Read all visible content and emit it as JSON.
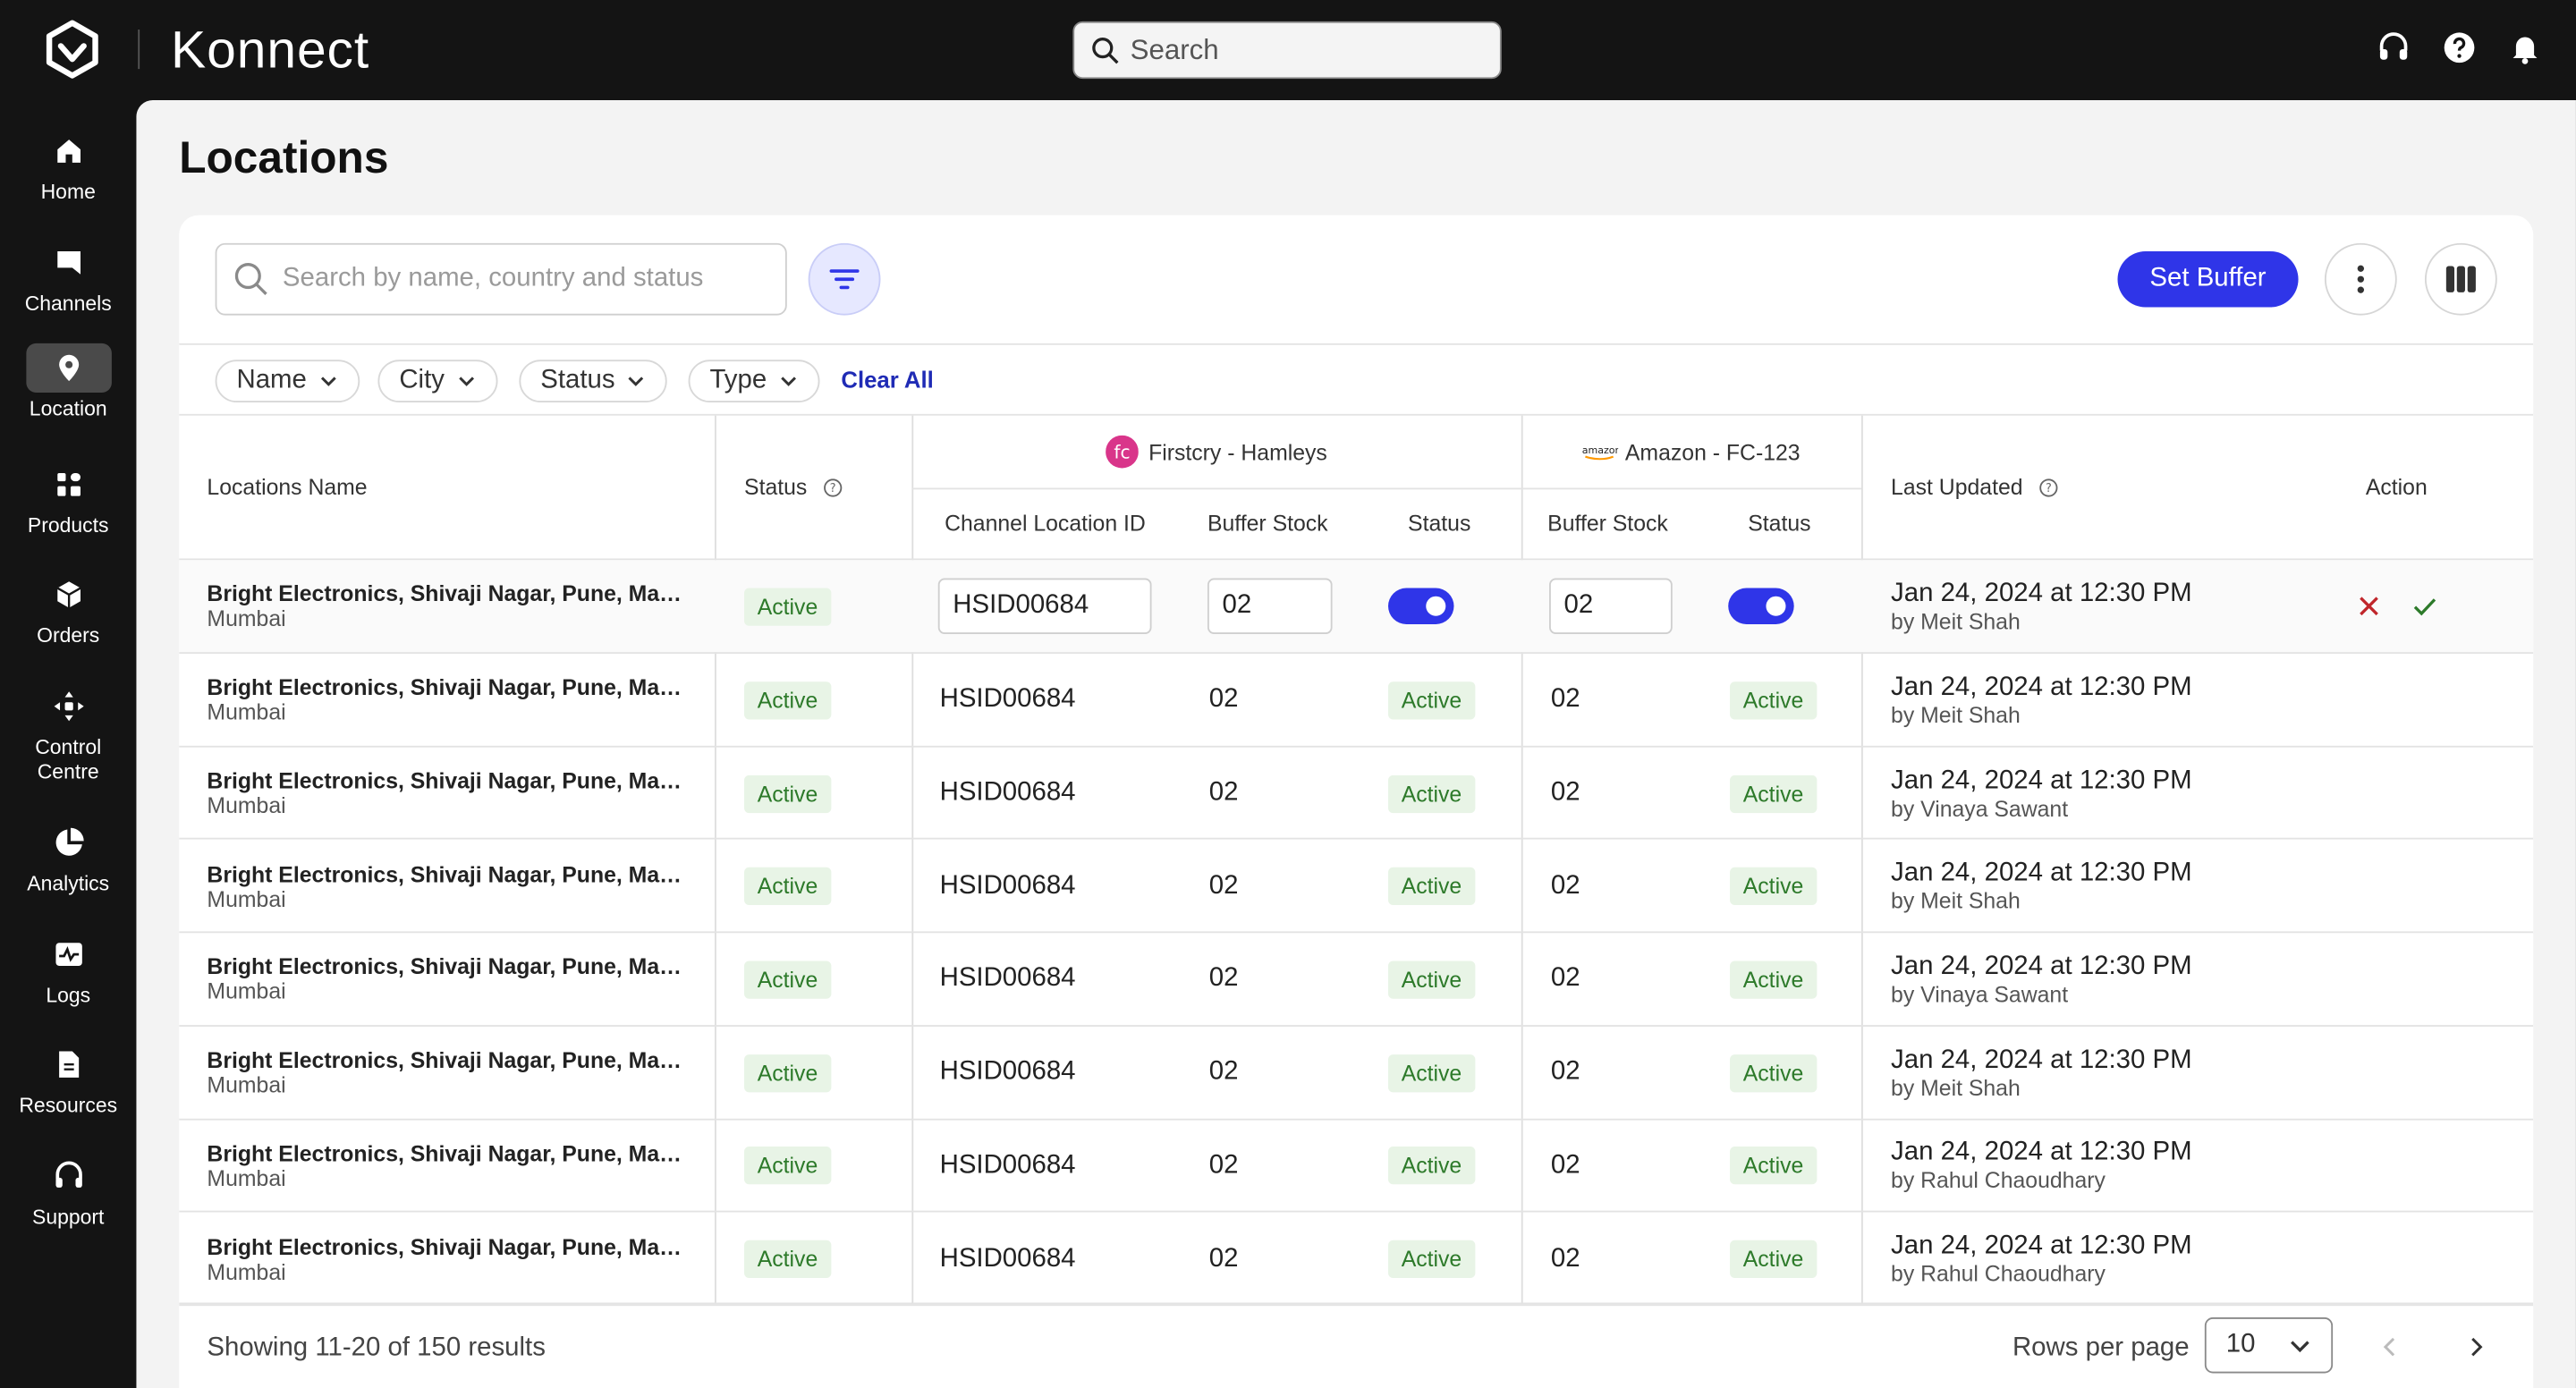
{
  "app": {
    "brand": "Konnect"
  },
  "header": {
    "search_placeholder": "Search"
  },
  "colors": {
    "accent": "#2f35e8",
    "active_badge_bg": "#e8f4e6",
    "active_badge_text": "#2d7a2a",
    "topbar": "#141414"
  },
  "sidebar": {
    "items": [
      {
        "label": "Home",
        "icon": "home-icon"
      },
      {
        "label": "Channels",
        "icon": "channels-icon"
      },
      {
        "label": "Location",
        "icon": "location-pin-icon",
        "active": true
      },
      {
        "label": "Products",
        "icon": "products-icon"
      },
      {
        "label": "Orders",
        "icon": "orders-box-icon"
      },
      {
        "label": "Control",
        "label2": "Centre",
        "icon": "control-centre-icon"
      },
      {
        "label": "Analytics",
        "icon": "analytics-pie-icon"
      },
      {
        "label": "Logs",
        "icon": "logs-icon"
      },
      {
        "label": "Resources",
        "icon": "resources-doc-icon"
      },
      {
        "label": "Support",
        "icon": "support-headset-icon"
      }
    ]
  },
  "page": {
    "title": "Locations",
    "search_placeholder": "Search by name, country and status",
    "set_buffer": "Set Buffer",
    "filters": [
      "Name",
      "City",
      "Status",
      "Type"
    ],
    "clear_all": "Clear All"
  },
  "table": {
    "headers": {
      "location_name": "Locations Name",
      "status": "Status",
      "channel1": "Firstcry - Hamleys",
      "channel2": "Amazon - FC-123",
      "channel_location_id": "Channel Location ID",
      "buffer_stock": "Buffer Stock",
      "sub_status": "Status",
      "buffer_stock2": "Buffer Stock",
      "sub_status2": "Status",
      "last_updated": "Last Updated",
      "action": "Action"
    },
    "edit_row": {
      "name": "Bright Electronics, Shivaji Nagar, Pune, Maharashtra",
      "city": "Mumbai",
      "status": "Active",
      "channel_location_id": "HSID00684",
      "buffer1": "02",
      "buffer2": "02",
      "updated": "Jan 24, 2024 at 12:30 PM",
      "by": "by Meit Shah"
    },
    "rows": [
      {
        "name": "Bright Electronics, Shivaji Nagar, Pune, Maharashtra",
        "city": "Mumbai",
        "status": "Active",
        "cid": "HSID00684",
        "b1": "02",
        "s1": "Active",
        "b2": "02",
        "s2": "Active",
        "updated": "Jan 24, 2024 at 12:30 PM",
        "by": "by Meit Shah"
      },
      {
        "name": "Bright Electronics, Shivaji Nagar, Pune, Maharashtra",
        "city": "Mumbai",
        "status": "Active",
        "cid": "HSID00684",
        "b1": "02",
        "s1": "Active",
        "b2": "02",
        "s2": "Active",
        "updated": "Jan 24, 2024 at 12:30 PM",
        "by": "by Vinaya Sawant"
      },
      {
        "name": "Bright Electronics, Shivaji Nagar, Pune, Maharashtra",
        "city": "Mumbai",
        "status": "Active",
        "cid": "HSID00684",
        "b1": "02",
        "s1": "Active",
        "b2": "02",
        "s2": "Active",
        "updated": "Jan 24, 2024 at 12:30 PM",
        "by": "by Meit Shah"
      },
      {
        "name": "Bright Electronics, Shivaji Nagar, Pune, Maharashtra",
        "city": "Mumbai",
        "status": "Active",
        "cid": "HSID00684",
        "b1": "02",
        "s1": "Active",
        "b2": "02",
        "s2": "Active",
        "updated": "Jan 24, 2024 at 12:30 PM",
        "by": "by Vinaya Sawant"
      },
      {
        "name": "Bright Electronics, Shivaji Nagar, Pune, Maharashtra",
        "city": "Mumbai",
        "status": "Active",
        "cid": "HSID00684",
        "b1": "02",
        "s1": "Active",
        "b2": "02",
        "s2": "Active",
        "updated": "Jan 24, 2024 at 12:30 PM",
        "by": "by Meit Shah"
      },
      {
        "name": "Bright Electronics, Shivaji Nagar, Pune, Maharashtra",
        "city": "Mumbai",
        "status": "Active",
        "cid": "HSID00684",
        "b1": "02",
        "s1": "Active",
        "b2": "02",
        "s2": "Active",
        "updated": "Jan 24, 2024 at 12:30 PM",
        "by": "by Rahul Chaoudhary"
      },
      {
        "name": "Bright Electronics, Shivaji Nagar, Pune, Maharashtra",
        "city": "Mumbai",
        "status": "Active",
        "cid": "HSID00684",
        "b1": "02",
        "s1": "Active",
        "b2": "02",
        "s2": "Active",
        "updated": "Jan 24, 2024 at 12:30 PM",
        "by": "by Rahul Chaoudhary"
      }
    ]
  },
  "footer": {
    "showing": "Showing 11-20 of 150 results",
    "rows_per_page_label": "Rows per page",
    "rows_per_page": "10"
  }
}
